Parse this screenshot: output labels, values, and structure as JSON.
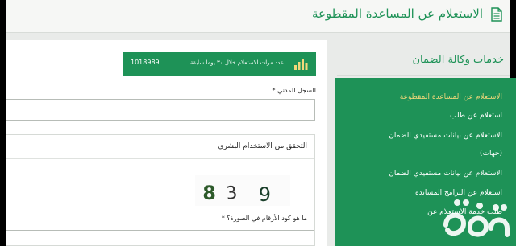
{
  "header": {
    "title": "الاستعلام عن المساعدة المقطوعة",
    "icon": "document-icon"
  },
  "stats": {
    "label": "عدد مرات الاستعلام خلال ٣٠ يوما سابقة",
    "count": "1018989",
    "icon": "bar-chart-icon"
  },
  "form": {
    "civil_id_label": "السجل المدني *",
    "civil_id_value": "",
    "captcha": {
      "title": "التحقق من الاستخدام البشري",
      "image_text": "2 8 3 9",
      "question": "ما هو كود الأرقام في الصورة؟ *",
      "answer_value": ""
    }
  },
  "sidebar": {
    "heading": "خدمات وكالة الضمان",
    "items": [
      {
        "label": "الاستعلام عن المساعدة المقطوعة",
        "active": true
      },
      {
        "label": "استعلام عن طلب",
        "active": false
      },
      {
        "label": "الاستعلام عن بيانات مستفيدي الضمان",
        "active": false
      },
      {
        "label": "(جهات)",
        "active": false
      },
      {
        "label": "الاستعلام عن بيانات مستفيدي الضمان",
        "active": false
      },
      {
        "label": "استعلام عن البرامج المساندة",
        "active": false
      },
      {
        "label": "طلب خدمة الاستعلام عن",
        "active": false
      }
    ]
  },
  "colors": {
    "brand_green": "#1e9257",
    "active_gold": "#f2d87a",
    "page_bg": "#e9ebe9"
  }
}
